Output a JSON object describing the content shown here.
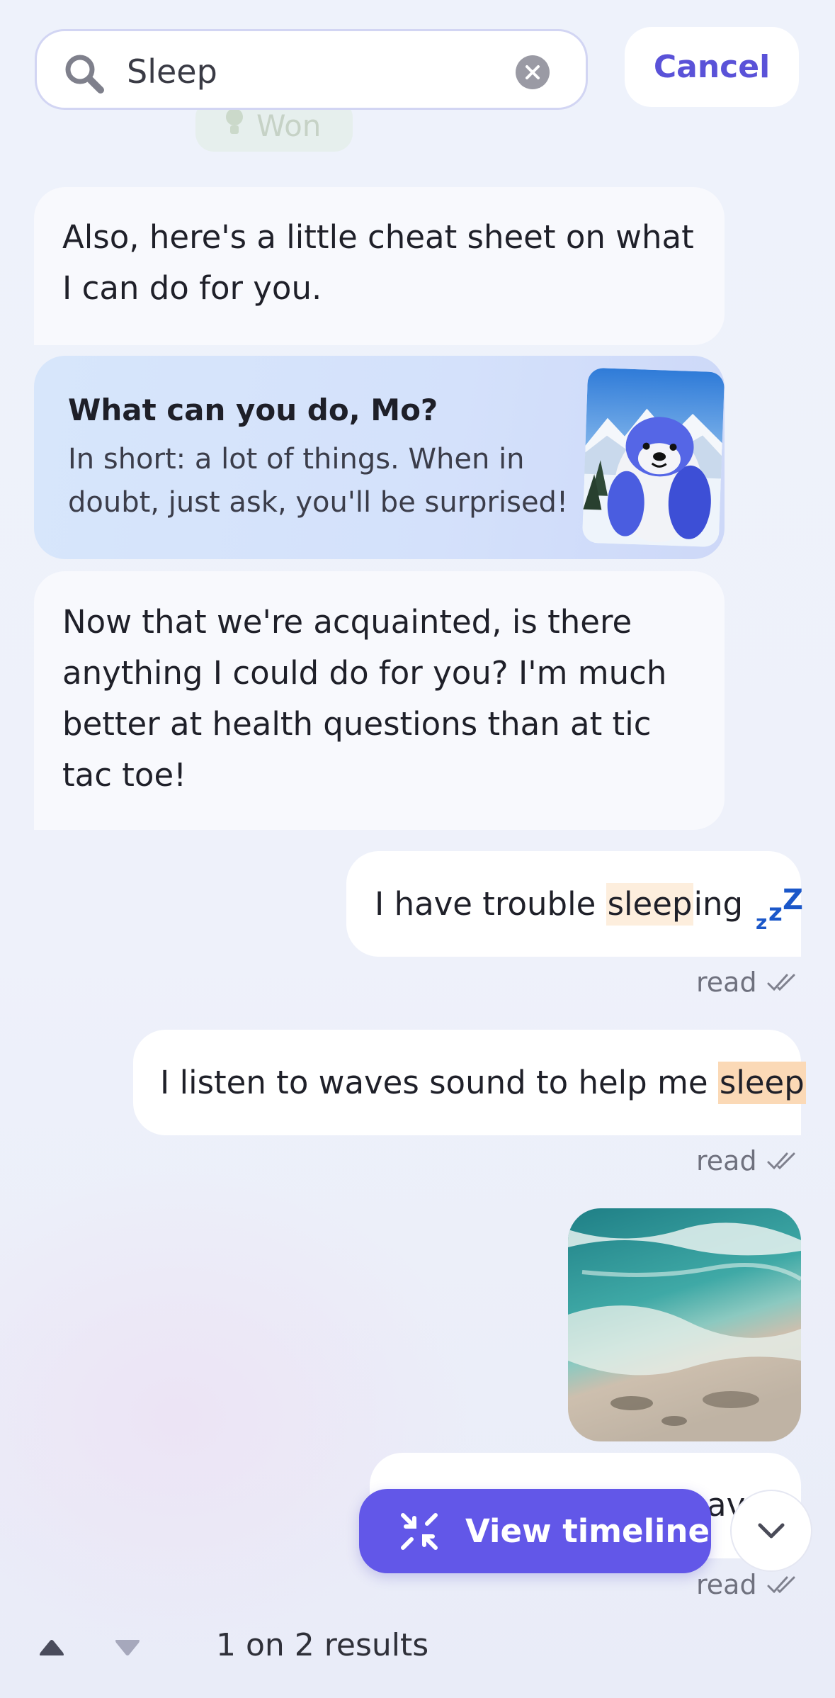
{
  "search": {
    "query": "Sleep",
    "cancel_label": "Cancel",
    "ghost_chip_label": "Won"
  },
  "messages": {
    "bot_1": "Also, here's a little cheat sheet on what I can do for you.",
    "card": {
      "title": "What can you do, Mo?",
      "body": "In short: a lot of things. When in doubt, just ask, you'll be surprised!"
    },
    "bot_2": "Now that we're acquainted, is there anything I could do for you? I'm much better at health questions than at tic tac toe!",
    "user_1": {
      "before": "I have trouble ",
      "highlight": "sleep",
      "after": "ing",
      "emoji_icon": "zzz-sleep-icon"
    },
    "user_2": {
      "before": "I listen to waves sound to help me ",
      "highlight": "sleep"
    },
    "user_3_partial": "av",
    "read_label": "read"
  },
  "timeline": {
    "label": "View timeline"
  },
  "footer": {
    "result_count": "1 on 2 results"
  },
  "colors": {
    "accent": "#6257e8",
    "cancel_text": "#5a52d8",
    "highlight_light": "#fdeedd",
    "highlight_strong": "#fbd9b6",
    "zzz": "#1b57c9"
  }
}
